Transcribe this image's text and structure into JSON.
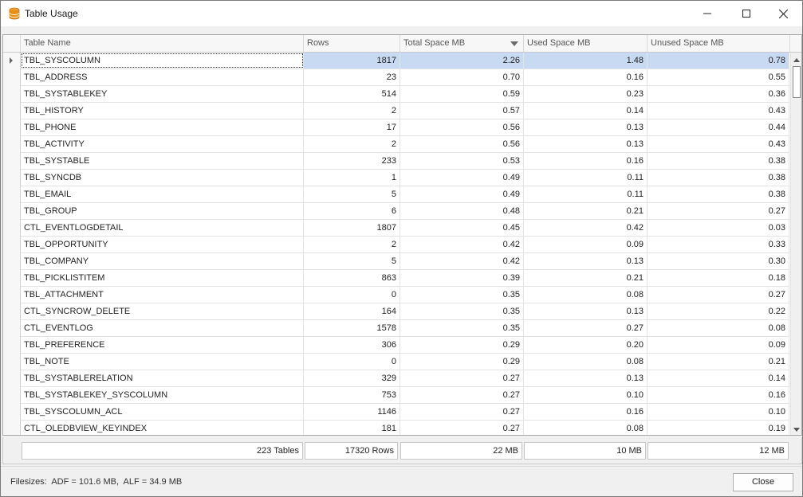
{
  "window": {
    "title": "Table Usage",
    "icon": "database-icon"
  },
  "columns": [
    {
      "label": "Table Name"
    },
    {
      "label": "Rows"
    },
    {
      "label": "Total Space MB",
      "sorted": "desc"
    },
    {
      "label": "Used Space MB"
    },
    {
      "label": "Unused Space MB"
    }
  ],
  "rows": [
    [
      "TBL_SYSCOLUMN",
      "1817",
      "2.26",
      "1.48",
      "0.78"
    ],
    [
      "TBL_ADDRESS",
      "23",
      "0.70",
      "0.16",
      "0.55"
    ],
    [
      "TBL_SYSTABLEKEY",
      "514",
      "0.59",
      "0.23",
      "0.36"
    ],
    [
      "TBL_HISTORY",
      "2",
      "0.57",
      "0.14",
      "0.43"
    ],
    [
      "TBL_PHONE",
      "17",
      "0.56",
      "0.13",
      "0.44"
    ],
    [
      "TBL_ACTIVITY",
      "2",
      "0.56",
      "0.13",
      "0.43"
    ],
    [
      "TBL_SYSTABLE",
      "233",
      "0.53",
      "0.16",
      "0.38"
    ],
    [
      "TBL_SYNCDB",
      "1",
      "0.49",
      "0.11",
      "0.38"
    ],
    [
      "TBL_EMAIL",
      "5",
      "0.49",
      "0.11",
      "0.38"
    ],
    [
      "TBL_GROUP",
      "6",
      "0.48",
      "0.21",
      "0.27"
    ],
    [
      "CTL_EVENTLOGDETAIL",
      "1807",
      "0.45",
      "0.42",
      "0.03"
    ],
    [
      "TBL_OPPORTUNITY",
      "2",
      "0.42",
      "0.09",
      "0.33"
    ],
    [
      "TBL_COMPANY",
      "5",
      "0.42",
      "0.13",
      "0.30"
    ],
    [
      "TBL_PICKLISTITEM",
      "863",
      "0.39",
      "0.21",
      "0.18"
    ],
    [
      "TBL_ATTACHMENT",
      "0",
      "0.35",
      "0.08",
      "0.27"
    ],
    [
      "CTL_SYNCROW_DELETE",
      "164",
      "0.35",
      "0.13",
      "0.22"
    ],
    [
      "CTL_EVENTLOG",
      "1578",
      "0.35",
      "0.27",
      "0.08"
    ],
    [
      "TBL_PREFERENCE",
      "306",
      "0.29",
      "0.20",
      "0.09"
    ],
    [
      "TBL_NOTE",
      "0",
      "0.29",
      "0.08",
      "0.21"
    ],
    [
      "TBL_SYSTABLERELATION",
      "329",
      "0.27",
      "0.13",
      "0.14"
    ],
    [
      "TBL_SYSTABLEKEY_SYSCOLUMN",
      "753",
      "0.27",
      "0.10",
      "0.16"
    ],
    [
      "TBL_SYSCOLUMN_ACL",
      "1146",
      "0.27",
      "0.16",
      "0.10"
    ],
    [
      "CTL_OLEDBVIEW_KEYINDEX",
      "181",
      "0.27",
      "0.08",
      "0.19"
    ]
  ],
  "selected_row": 0,
  "summary": {
    "tables": "223 Tables",
    "rows": "17320 Rows",
    "total": "22 MB",
    "used": "10 MB",
    "unused": "12 MB"
  },
  "status": {
    "filesizes": "Filesizes:  ADF = 101.6 MB,  ALF = 34.9 MB",
    "close_label": "Close"
  }
}
